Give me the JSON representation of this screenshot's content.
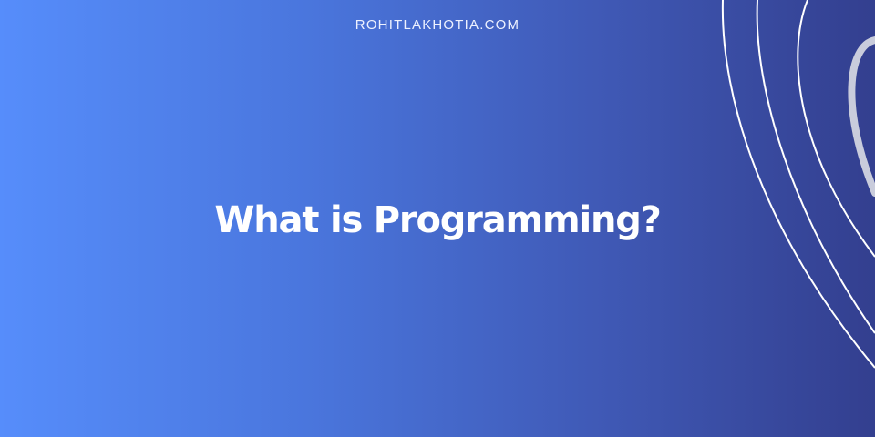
{
  "banner": {
    "site_name": "ROHITLAKHOTIA.COM",
    "title": "What is Programming?"
  },
  "colors": {
    "gradient_start": "#568dfb",
    "gradient_end": "#333f8f",
    "text": "#ffffff",
    "decor_line": "#ffffff",
    "decor_thick_line": "#c9ccdc"
  }
}
